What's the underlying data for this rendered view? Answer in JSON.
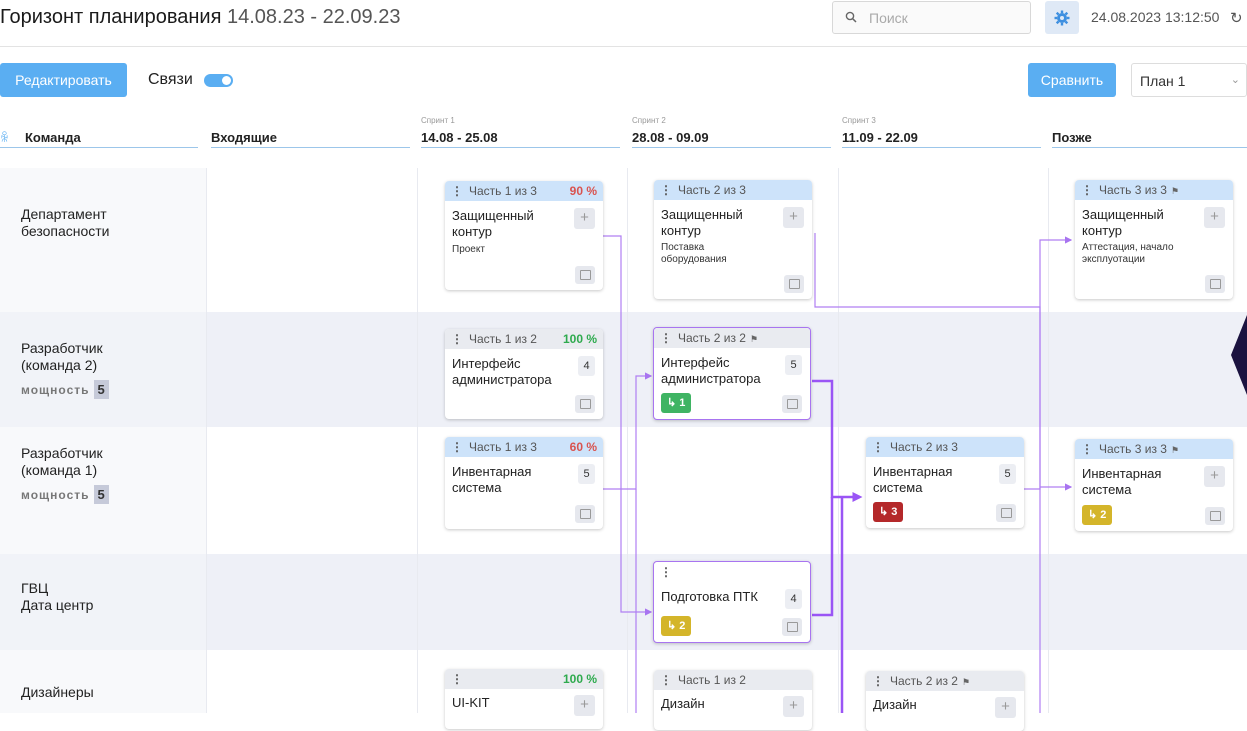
{
  "header": {
    "title": "Горизонт планирования",
    "range": "14.08.23 - 22.09.23",
    "search_placeholder": "Поиск",
    "datetime": "24.08.2023 13:12:50"
  },
  "toolbar": {
    "edit_label": "Редактировать",
    "links_label": "Связи",
    "links_enabled": true,
    "compare_label": "Сравнить",
    "plan_value": "План 1"
  },
  "columns": [
    {
      "label": "Команда"
    },
    {
      "label": "Входящие"
    },
    {
      "sprint": "Спринт 1",
      "label": "14.08 - 25.08"
    },
    {
      "sprint": "Спринт 2",
      "label": "28.08 - 09.09"
    },
    {
      "sprint": "Спринт 3",
      "label": "11.09 - 22.09"
    },
    {
      "label": "Позже"
    }
  ],
  "rows": [
    {
      "label": "Департамент\nбезопасности"
    },
    {
      "label": "Разработчик\n(команда 2)",
      "capacity_label": "мощность",
      "capacity": "5"
    },
    {
      "label": "Разработчик\n(команда 1)",
      "capacity_label": "мощность",
      "capacity": "5"
    },
    {
      "label": "ГВЦ\nДата центр"
    },
    {
      "label": "Дизайнеры"
    }
  ],
  "cards": {
    "c1": {
      "part": "Часть 1 из 3",
      "pct": "90 %",
      "name": "Защищенный контур",
      "desc": "Проект"
    },
    "c2": {
      "part": "Часть 2 из 3",
      "name": "Защищенный контур",
      "desc": "Поставка оборудования"
    },
    "c3": {
      "part": "Часть 3 из 3",
      "name": "Защищенный контур",
      "desc": "Аттестация, начало эксплуотации"
    },
    "c4": {
      "part": "Часть 1 из 2",
      "pct": "100 %",
      "name": "Интерфейс администратора",
      "count": "4"
    },
    "c5": {
      "part": "Часть 2 из 2",
      "name": "Интерфейс администратора",
      "count": "5",
      "badge": "1"
    },
    "c6": {
      "part": "Часть 1 из 3",
      "pct": "60 %",
      "name": "Инвентарная система",
      "count": "5"
    },
    "c7": {
      "part": "Часть 2 из 3",
      "name": "Инвентарная система",
      "count": "5",
      "badge": "3"
    },
    "c8": {
      "part": "Часть 3 из 3",
      "name": "Инвентарная система",
      "badge": "2"
    },
    "c9": {
      "name": "Подготовка ПТК",
      "count": "4",
      "badge": "2"
    },
    "c10": {
      "pct": "100 %",
      "name": "UI-KIT"
    },
    "c11": {
      "part": "Часть 1 из 2",
      "name": "Дизайн"
    },
    "c12": {
      "part": "Часть 2 из 2",
      "name": "Дизайн"
    }
  },
  "colors": {
    "accent": "#5aaef2",
    "link": "#a874f0",
    "row_alt": "#eef0f7"
  }
}
